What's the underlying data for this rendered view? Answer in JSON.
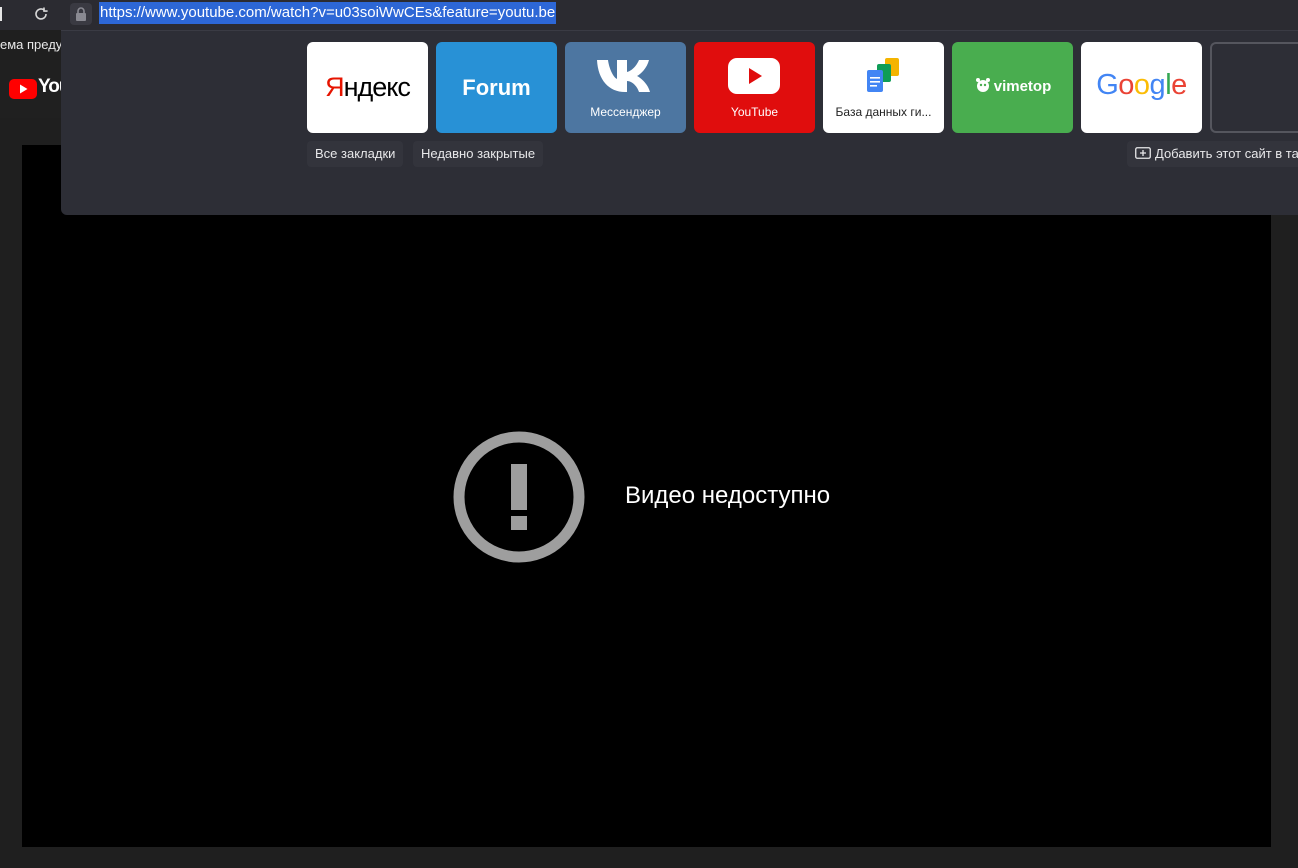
{
  "browser": {
    "url": "https://www.youtube.com/watch?v=u03soiWwCEs&feature=youtu.be"
  },
  "page": {
    "banner_text": "ема предуп",
    "yt_word": "You",
    "error_message": "Видео недоступно"
  },
  "speed_dial": {
    "tiles": [
      {
        "label": "",
        "logo_text_a": "Я",
        "logo_text_b": "ндекс"
      },
      {
        "label": "",
        "logo_text": "Forum"
      },
      {
        "label": "Мессенджер"
      },
      {
        "label": "YouTube"
      },
      {
        "label": "База данных ги..."
      },
      {
        "label": "",
        "logo_text": "vimetop"
      },
      {
        "label": "",
        "logo_text": "Google"
      }
    ],
    "all_bookmarks": "Все закладки",
    "recently_closed": "Недавно закрытые",
    "add_site": "Добавить этот сайт в та"
  },
  "colors": {
    "accent_selection": "#2d67d6",
    "youtube_red": "#e00d0d",
    "forum_blue": "#2891d6",
    "vk_blue": "#4d76a1",
    "vimetop_green": "#49ad4f"
  }
}
